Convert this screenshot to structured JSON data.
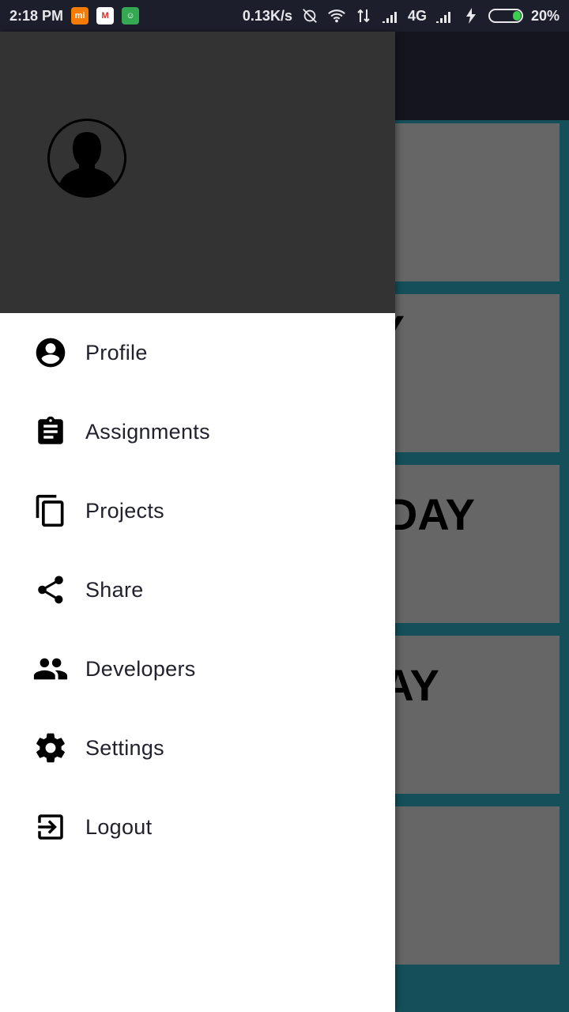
{
  "status_bar": {
    "time": "2:18 PM",
    "notifications": [
      "mi-icon",
      "gmail-icon",
      "android-icon"
    ],
    "net_speed": "0.13K/s",
    "network": "4G",
    "battery": "20%",
    "battery_level": 0.2
  },
  "background_app": {
    "tiles": [
      "",
      "Y",
      "DAY",
      "AY",
      ""
    ]
  },
  "drawer": {
    "avatar_icon": "person-avatar-icon",
    "menu": [
      {
        "label": "Profile",
        "icon": "account-circle-icon"
      },
      {
        "label": "Assignments",
        "icon": "clipboard-icon"
      },
      {
        "label": "Projects",
        "icon": "copy-icon"
      },
      {
        "label": "Share",
        "icon": "share-icon"
      },
      {
        "label": "Developers",
        "icon": "people-icon"
      },
      {
        "label": "Settings",
        "icon": "gear-icon"
      },
      {
        "label": "Logout",
        "icon": "exit-icon"
      }
    ]
  },
  "colors": {
    "drawer_header": "#333333",
    "tile": "#666666",
    "app_bg": "#15505a",
    "toolbar": "#15151f"
  }
}
